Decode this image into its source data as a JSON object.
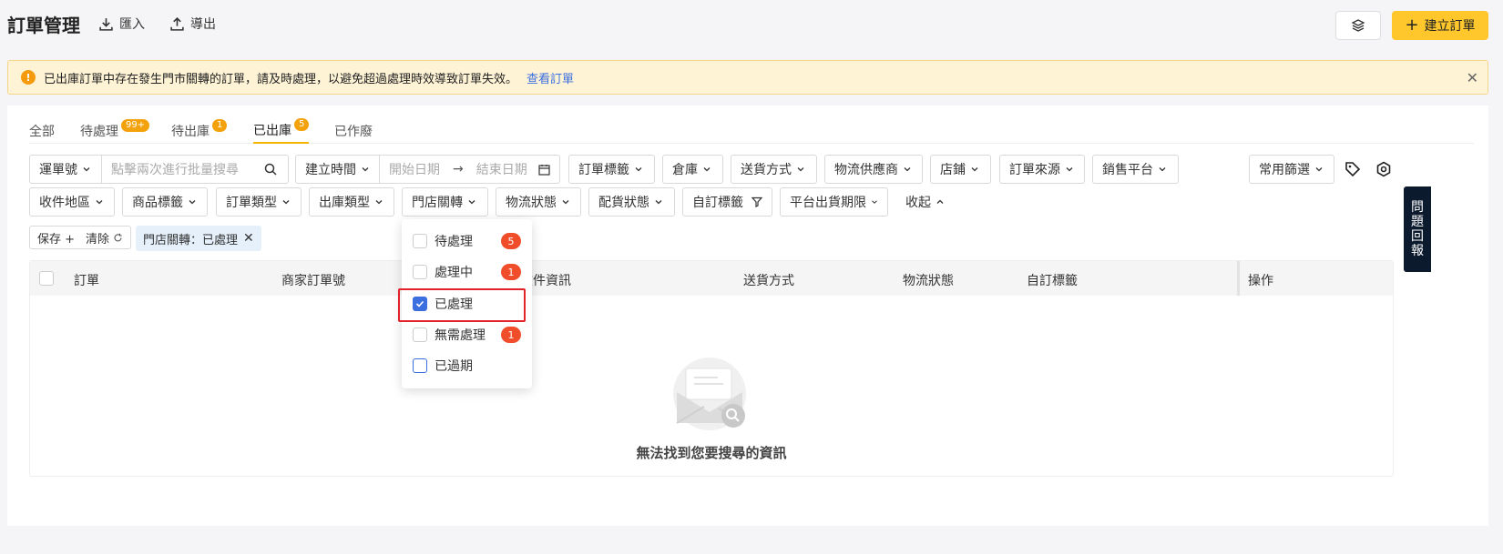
{
  "header": {
    "title": "訂單管理",
    "import_label": "匯入",
    "export_label": "導出",
    "create_label": "建立訂單"
  },
  "alert": {
    "message": "已出庫訂單中存在發生門市關轉的訂單，請及時處理，以避免超過處理時效導致訂單失效。",
    "link": "查看訂單"
  },
  "tabs": [
    {
      "label": "全部",
      "badge": ""
    },
    {
      "label": "待處理",
      "badge": "99+"
    },
    {
      "label": "待出庫",
      "badge": "1"
    },
    {
      "label": "已出庫",
      "badge": "5"
    },
    {
      "label": "已作廢",
      "badge": ""
    }
  ],
  "filters": {
    "tracking_select": "運單號",
    "search_placeholder": "點擊兩次進行批量搜尋",
    "time_select": "建立時間",
    "start_date_placeholder": "開始日期",
    "arrow": "→",
    "end_date_placeholder": "結束日期",
    "row1": [
      "訂單標籤",
      "倉庫",
      "送貨方式",
      "物流供應商",
      "店鋪",
      "訂單來源",
      "銷售平台"
    ],
    "common_filter": "常用篩選",
    "row2": [
      "收件地區",
      "商品標籤",
      "訂單類型",
      "出庫類型",
      "門店關轉",
      "物流狀態",
      "配貨狀態",
      "自訂標籤",
      "平台出貨期限"
    ],
    "collapse": "收起"
  },
  "actions": {
    "save": "保存 +",
    "clear": "清除",
    "active_tag": "門店關轉：已處理"
  },
  "table": {
    "columns": [
      "訂單",
      "商家訂單號",
      "收件資訊",
      "送貨方式",
      "物流狀態",
      "自訂標籤",
      "操作"
    ],
    "empty_text": "無法找到您要搜尋的資訊"
  },
  "dropdown": {
    "items": [
      {
        "label": "待處理",
        "count": "5",
        "checked": false
      },
      {
        "label": "處理中",
        "count": "1",
        "checked": false
      },
      {
        "label": "已處理",
        "count": "",
        "checked": true
      },
      {
        "label": "無需處理",
        "count": "1",
        "checked": false
      },
      {
        "label": "已過期",
        "count": "",
        "checked": false
      }
    ]
  },
  "side_tab": [
    "問",
    "題",
    "回",
    "報"
  ],
  "colors": {
    "accent": "#ffc72c",
    "link": "#3b6fe0",
    "badge": "#f04e2a"
  }
}
